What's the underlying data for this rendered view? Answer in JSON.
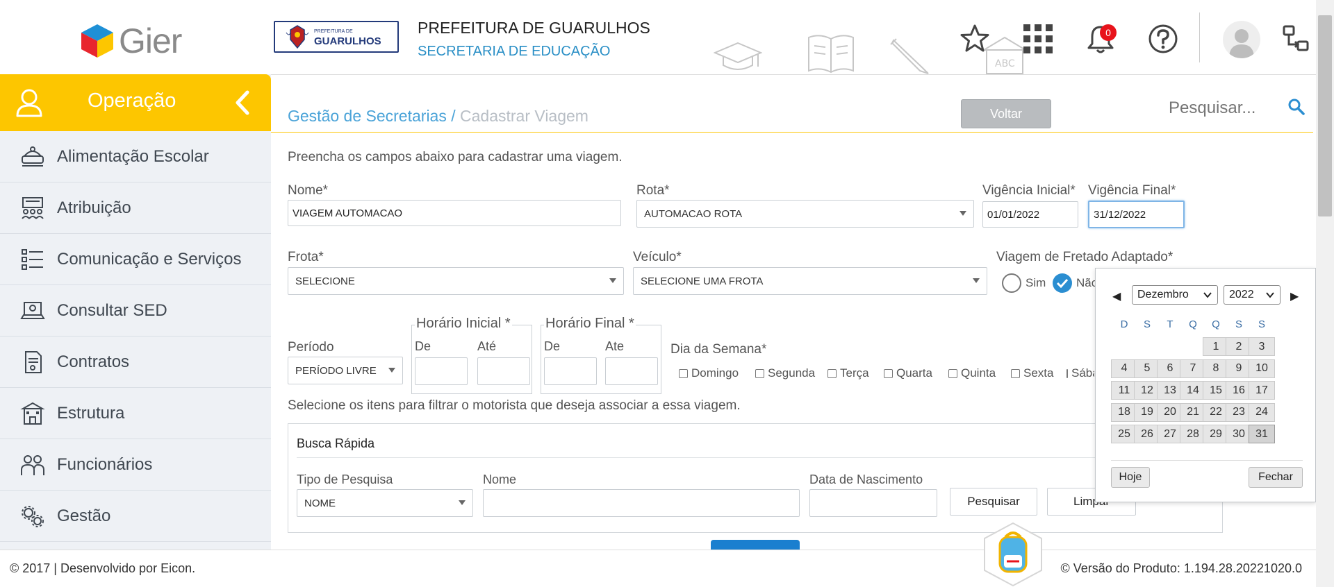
{
  "header": {
    "logo_text": "Gier",
    "city_seal_text": "GUARULHOS",
    "city_seal_small": "PREFEITURA DE",
    "org_title": "PREFEITURA DE GUARULHOS",
    "org_subtitle": "SECRETARIA DE EDUCAÇÃO",
    "notification_count": "0",
    "icons": [
      "star-icon",
      "apps-grid-icon",
      "bell-icon",
      "help-icon",
      "avatar",
      "switch-profile-icon"
    ]
  },
  "sidebar": {
    "title": "Operação",
    "items": [
      {
        "label": "Alimentação Escolar",
        "icon": "school-meal-icon"
      },
      {
        "label": "Atribuição",
        "icon": "assignment-icon"
      },
      {
        "label": "Comunicação e Serviços",
        "icon": "checklist-icon"
      },
      {
        "label": "Consultar SED",
        "icon": "laptop-icon"
      },
      {
        "label": "Contratos",
        "icon": "contract-icon"
      },
      {
        "label": "Estrutura",
        "icon": "building-icon"
      },
      {
        "label": "Funcionários",
        "icon": "people-icon"
      },
      {
        "label": "Gestão",
        "icon": "gears-icon"
      }
    ]
  },
  "main": {
    "breadcrumb": {
      "link": "Gestão de Secretarias",
      "separator": " / ",
      "current": "Cadastrar Viagem"
    },
    "back_button": "Voltar",
    "search_placeholder": "Pesquisar...",
    "intro": "Preencha os campos abaixo para cadastrar uma viagem.",
    "form": {
      "nome_label": "Nome*",
      "nome_value": "VIAGEM AUTOMACAO",
      "rota_label": "Rota*",
      "rota_value": "AUTOMACAO ROTA",
      "vig_ini_label": "Vigência Inicial*",
      "vig_ini_value": "01/01/2022",
      "vig_fin_label": "Vigência Final*",
      "vig_fin_value": "31/12/2022",
      "frota_label": "Frota*",
      "frota_value": "SELECIONE",
      "veiculo_label": "Veículo*",
      "veiculo_value": "SELECIONE UMA FROTA",
      "fretado_label": "Viagem de Fretado Adaptado*",
      "fretado_sim": "Sim",
      "fretado_nao": "Não",
      "periodo_label": "Período",
      "periodo_value": "PERÍODO LIVRE",
      "hor_ini_legend": "Horário Inicial *",
      "hor_fin_legend": "Horário Final *",
      "de_label": "De",
      "ate_label": "Até",
      "ate_label_2": "Ate",
      "dia_semana_label": "Dia da Semana*",
      "days": [
        "Domingo",
        "Segunda",
        "Terça",
        "Quarta",
        "Quinta",
        "Sexta",
        "Sábado"
      ],
      "driver_hint": "Selecione os itens para filtrar o motorista que deseja associar a essa viagem."
    },
    "busca": {
      "title": "Busca Rápida",
      "tipo_label": "Tipo de Pesquisa",
      "tipo_value": "NOME",
      "nome_label": "Nome",
      "nasc_label": "Data de Nascimento",
      "pesquisar_btn": "Pesquisar",
      "limpar_btn": "Limpar"
    }
  },
  "calendar": {
    "month": "Dezembro",
    "year": "2022",
    "weekdays": [
      "D",
      "S",
      "T",
      "Q",
      "Q",
      "S",
      "S"
    ],
    "first_weekday_index": 4,
    "days_in_month": 31,
    "selected_day": 31,
    "today_btn": "Hoje",
    "close_btn": "Fechar"
  },
  "footer": {
    "left": "© 2017 | Desenvolvido por Eicon.",
    "right": "© Versão do Produto: 1.194.28.20221020.0"
  }
}
